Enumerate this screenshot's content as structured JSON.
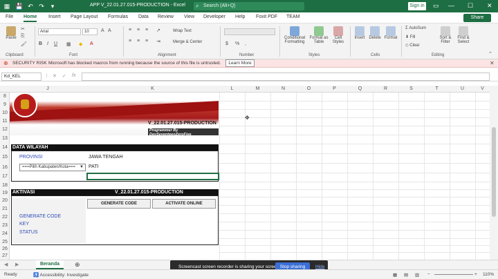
{
  "window": {
    "title": "APP V_22.01.27.015-PRODUCTION  -  Excel",
    "search_placeholder": "Search (Alt+Q)",
    "sign_in": "Sign in"
  },
  "ribbon_tabs": [
    "File",
    "Home",
    "Insert",
    "Page Layout",
    "Formulas",
    "Data",
    "Review",
    "View",
    "Developer",
    "Help",
    "Foxit PDF",
    "TEAM"
  ],
  "share_label": "Share",
  "ribbon": {
    "paste": "Paste",
    "font_name": "Arial",
    "font_size": "10",
    "wrap_text": "Wrap Text",
    "merge_center": "Merge & Center",
    "conditional": "Conditional Formatting",
    "format_table": "Format as Table",
    "cell_styles": "Cell Styles",
    "insert": "Insert",
    "delete": "Delete",
    "format": "Format",
    "autosum": "AutoSum",
    "fill": "Fill",
    "clear": "Clear",
    "sort_filter": "Sort & Filter",
    "find_select": "Find & Select",
    "groups": [
      "Clipboard",
      "Font",
      "Alignment",
      "Number",
      "Styles",
      "Cells",
      "Editing"
    ]
  },
  "security": {
    "label": "SECURITY RISK",
    "message": "Microsoft has blocked macros from running because the source of this file is untrusted.",
    "button": "Learn More"
  },
  "formula_bar": {
    "name_box": "Kd_KEL",
    "fx": "fx"
  },
  "columns": [
    "J",
    "K",
    "L",
    "M",
    "N",
    "O",
    "P",
    "Q",
    "R",
    "S",
    "T",
    "U",
    "V"
  ],
  "rows": [
    "8",
    "9",
    "10",
    "11",
    "12",
    "13",
    "14",
    "15",
    "16",
    "17",
    "18",
    "19",
    "20",
    "21",
    "22",
    "23",
    "24",
    "25",
    "26",
    "27"
  ],
  "banner": {
    "title": "PEMILIHAN SERENTAK TAHUN 2024",
    "version": "V_22.01.27.015-PRODUCTION",
    "programmer": "Programmer By DevSeventeenZeroFive"
  },
  "data_wilayah": {
    "header": "DATA WILAYAH",
    "provinsi_label": "PROVINSI",
    "provinsi_value": "JAWA TENGAH",
    "kabupaten_dropdown": "===Pilih Kabupaten/Kota===",
    "kabupaten_value": "PATI"
  },
  "aktivasi": {
    "header": "AKTIVASI",
    "version": "V_22.01.27.015-PRODUCTION",
    "generate_button": "GENERATE CODE",
    "activate_button": "ACTIVATE ONLINE",
    "generate_label": "GENERATE CODE",
    "key_label": "KEY",
    "status_label": "STATUS"
  },
  "sheet_tab": "Beranda",
  "screen_share": {
    "message": "Screencast screen recorder is sharing your screen.",
    "stop": "Stop sharing",
    "hide": "Hide"
  },
  "status": {
    "ready": "Ready",
    "accessibility": "Accessibility: Investigate",
    "zoom": "110%"
  }
}
